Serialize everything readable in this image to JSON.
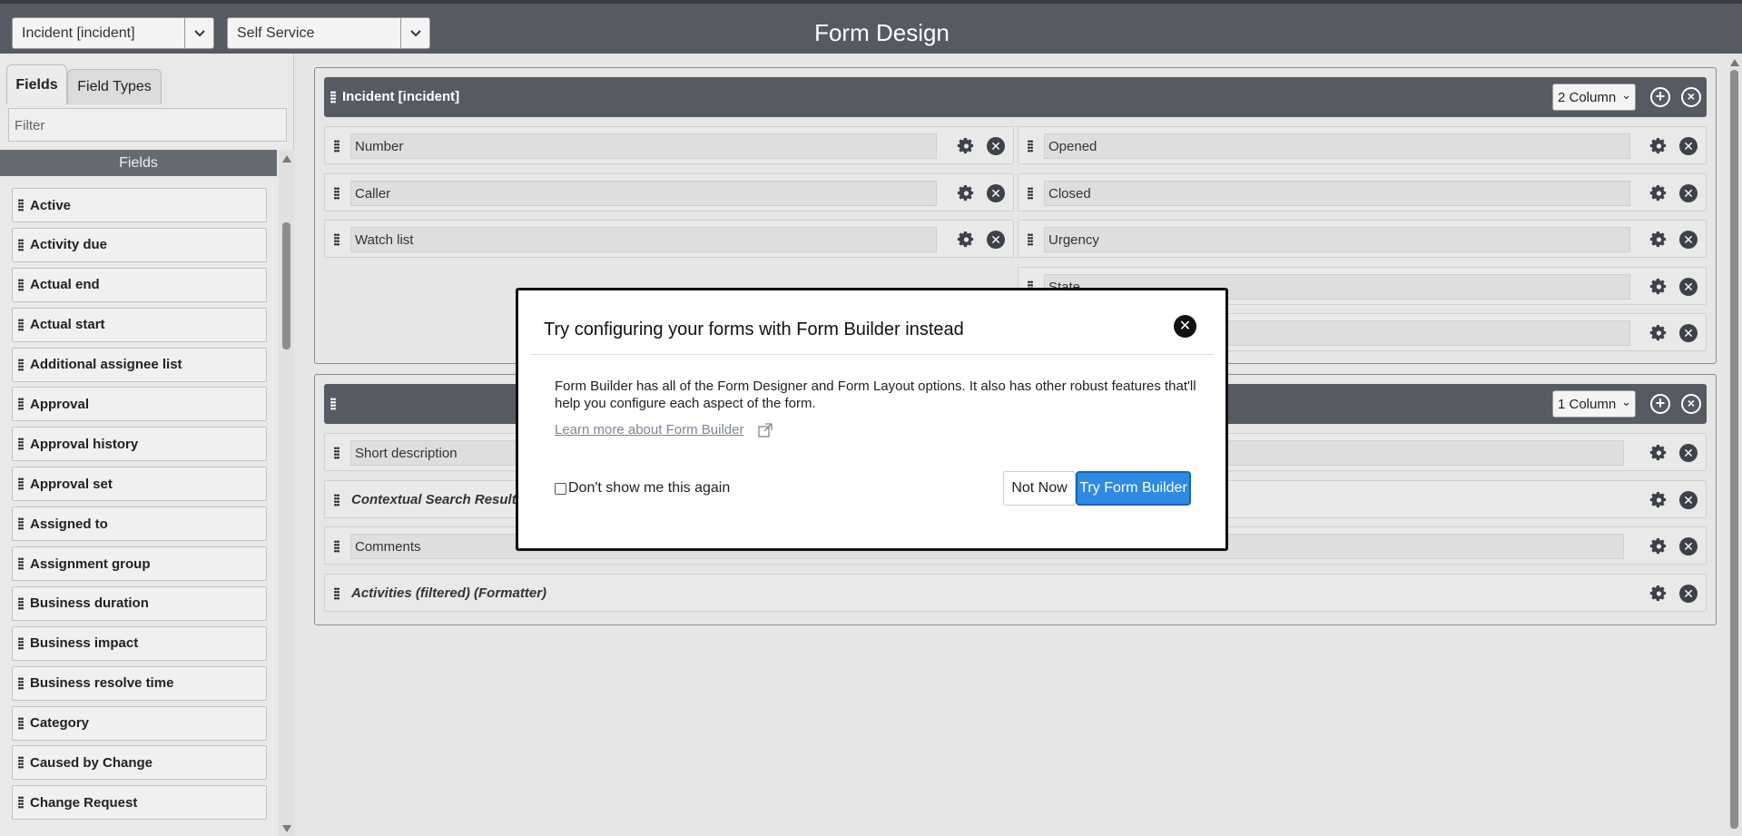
{
  "header": {
    "table_select": "Incident [incident]",
    "view_select": "Self Service",
    "title": "Form Design"
  },
  "left_panel": {
    "tabs": [
      "Fields",
      "Field Types"
    ],
    "filter_placeholder": "Filter",
    "section_label": "Fields",
    "fields": [
      "Active",
      "Activity due",
      "Actual end",
      "Actual start",
      "Additional assignee list",
      "Approval",
      "Approval history",
      "Approval set",
      "Assigned to",
      "Assignment group",
      "Business duration",
      "Business impact",
      "Business resolve time",
      "Category",
      "Caused by Change",
      "Change Request"
    ]
  },
  "section1": {
    "title": "Incident [incident]",
    "columns": "2 Column",
    "left_fields": [
      "Number",
      "Caller",
      "Watch list"
    ],
    "right_fields": [
      "Opened",
      "Closed",
      "Urgency",
      "State",
      ""
    ]
  },
  "section2": {
    "title": "",
    "columns": "1 Column",
    "rows": [
      {
        "label": "Short description",
        "type": "input"
      },
      {
        "label": "Contextual Search Results",
        "type": "formatter"
      },
      {
        "label": "Comments",
        "type": "input"
      },
      {
        "label": "Activities (filtered) (Formatter)",
        "type": "formatter"
      }
    ]
  },
  "modal": {
    "title": "Try configuring your forms with Form Builder instead",
    "body": "Form Builder has all of the Form Designer and Form Layout options. It also has other robust features that'll help you configure each aspect of the form.",
    "link": "Learn more about Form Builder",
    "checkbox_label": "Don't show me this again",
    "not_now": "Not Now",
    "try_button": "Try Form Builder",
    "accent_color": "#2f8ae4"
  },
  "icons": {
    "add": "plus-circle-icon",
    "remove": "close-circle-icon",
    "settings": "gear-icon",
    "drag": "drag-handle-icon",
    "external": "external-link-icon"
  }
}
